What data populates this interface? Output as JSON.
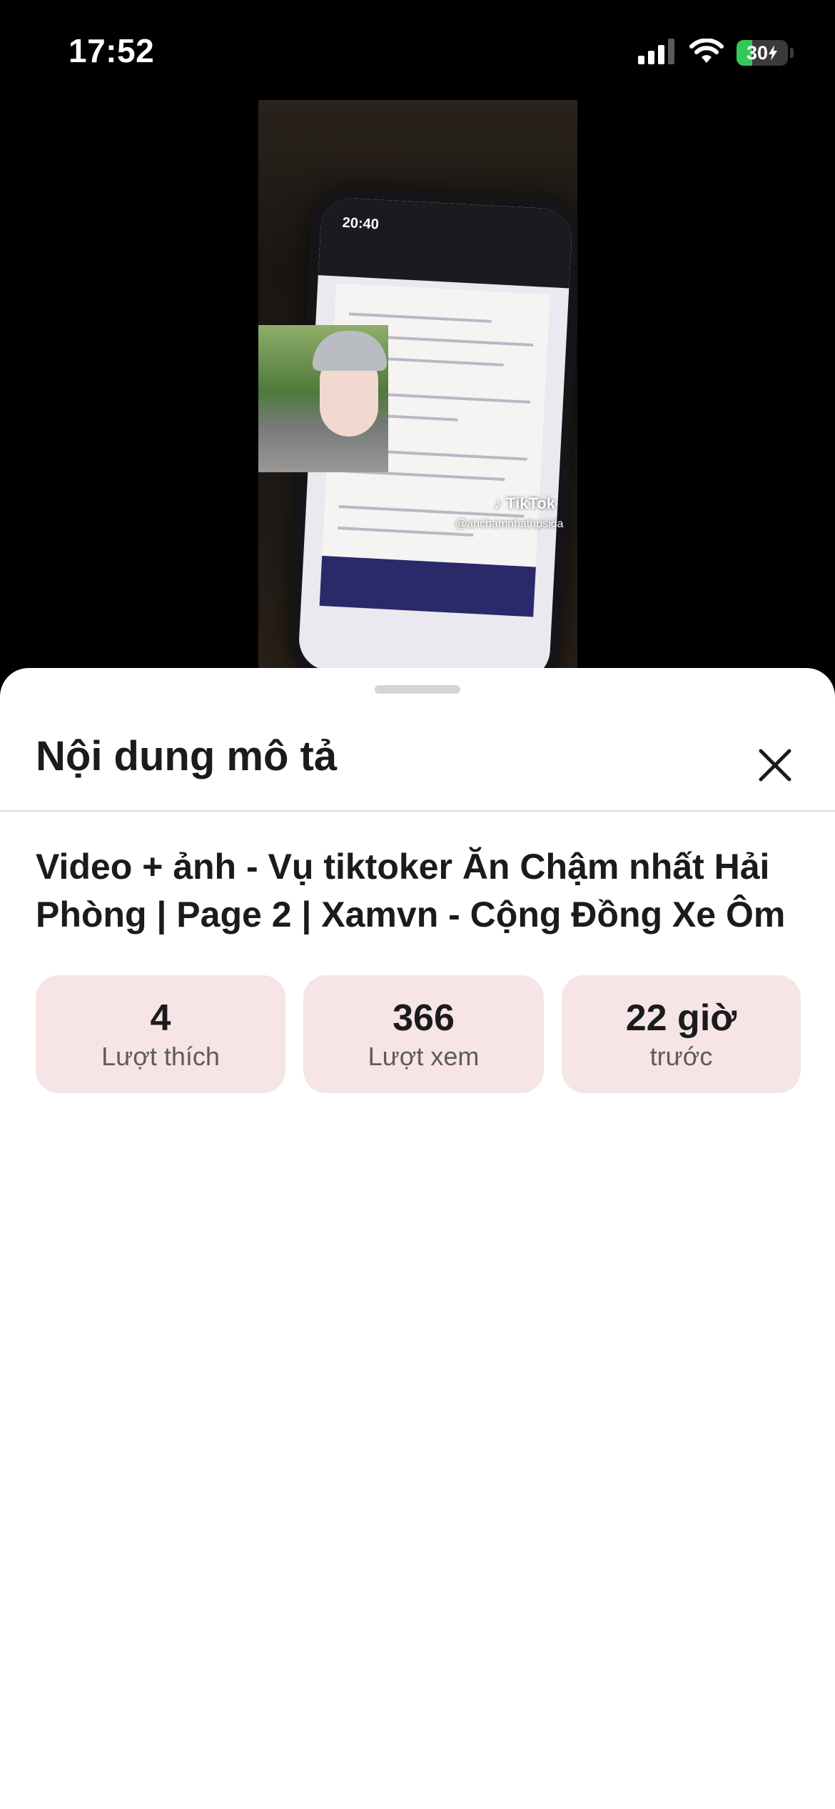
{
  "status_bar": {
    "time": "17:52",
    "battery_percent": "30",
    "battery_level": 0.3,
    "icons": [
      "cellular-signal-icon",
      "wifi-icon",
      "battery-charging-icon"
    ]
  },
  "video": {
    "phone_clock": "20:40",
    "watermark_brand": "TikTok",
    "watermark_handle": "@anchamnhathpsida"
  },
  "sheet": {
    "title": "Nội dung mô tả",
    "close_icon": "close-icon",
    "article_title": "Video + ảnh - Vụ tiktoker Ăn Chậm nhất Hải Phòng | Page 2 | Xamvn - Cộng Đồng Xe Ôm",
    "stats": [
      {
        "value": "4",
        "label": "Lượt thích"
      },
      {
        "value": "366",
        "label": "Lượt xem"
      },
      {
        "value": "22 giờ",
        "label": "trước"
      }
    ]
  },
  "colors": {
    "stat_card_bg": "#f6e4e7",
    "battery_green": "#34c759",
    "text_primary": "#1b1b1b"
  }
}
